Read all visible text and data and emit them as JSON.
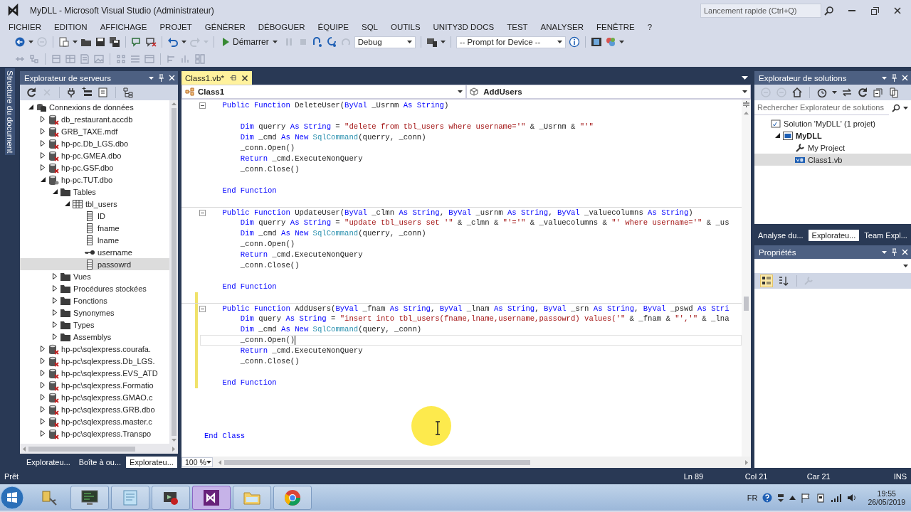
{
  "window": {
    "title": "MyDLL - Microsoft Visual Studio (Administrateur)",
    "quick_launch": {
      "placeholder": "Lancement rapide (Ctrl+Q)"
    }
  },
  "menu": [
    "FICHIER",
    "EDITION",
    "AFFICHAGE",
    "PROJET",
    "GÉNÉRER",
    "DÉBOGUER",
    "ÉQUIPE",
    "SQL",
    "OUTILS",
    "UNITY3D DOCS",
    "TEST",
    "ANALYSER",
    "FENÊTRE",
    "?"
  ],
  "toolbar": {
    "start": "Démarrer",
    "configuration": "Debug",
    "device": "-- Prompt for Device --"
  },
  "side_tab": "Structure du document",
  "server_explorer": {
    "title": "Explorateur de serveurs",
    "tree": [
      {
        "label": "Connexions de données",
        "kind": "connections",
        "expanded": true,
        "selected": false,
        "children": [
          {
            "label": "db_restaurant.accdb",
            "kind": "database",
            "connected": false,
            "expanded": false,
            "selected": false
          },
          {
            "label": "GRB_TAXE.mdf",
            "kind": "database",
            "connected": false,
            "expanded": false,
            "selected": false
          },
          {
            "label": "hp-pc.Db_LGS.dbo",
            "kind": "database",
            "connected": false,
            "expanded": false,
            "selected": false
          },
          {
            "label": "hp-pc.GMEA.dbo",
            "kind": "database",
            "connected": false,
            "expanded": false,
            "selected": false
          },
          {
            "label": "hp-pc.GSF.dbo",
            "kind": "database",
            "connected": false,
            "expanded": false,
            "selected": false
          },
          {
            "label": "hp-pc.TUT.dbo",
            "kind": "database",
            "connected": true,
            "expanded": true,
            "selected": false,
            "children": [
              {
                "label": "Tables",
                "kind": "folder",
                "expanded": true,
                "selected": false,
                "children": [
                  {
                    "label": "tbl_users",
                    "kind": "table",
                    "expanded": true,
                    "selected": false,
                    "children": [
                      {
                        "label": "ID",
                        "kind": "column",
                        "selected": false
                      },
                      {
                        "label": "fname",
                        "kind": "column",
                        "selected": false
                      },
                      {
                        "label": "lname",
                        "kind": "column",
                        "selected": false
                      },
                      {
                        "label": "username",
                        "kind": "key",
                        "selected": false
                      },
                      {
                        "label": "passowrd",
                        "kind": "column",
                        "selected": true
                      }
                    ]
                  }
                ]
              },
              {
                "label": "Vues",
                "kind": "folder",
                "expanded": false,
                "selected": false
              },
              {
                "label": "Procédures stockées",
                "kind": "folder",
                "expanded": false,
                "selected": false
              },
              {
                "label": "Fonctions",
                "kind": "folder",
                "expanded": false,
                "selected": false
              },
              {
                "label": "Synonymes",
                "kind": "folder",
                "expanded": false,
                "selected": false
              },
              {
                "label": "Types",
                "kind": "folder",
                "expanded": false,
                "selected": false
              },
              {
                "label": "Assemblys",
                "kind": "folder",
                "expanded": false,
                "selected": false
              }
            ]
          },
          {
            "label": "hp-pc\\sqlexpress.courafa.",
            "kind": "database",
            "connected": false,
            "expanded": false,
            "selected": false
          },
          {
            "label": "hp-pc\\sqlexpress.Db_LGS.",
            "kind": "database",
            "connected": false,
            "expanded": false,
            "selected": false
          },
          {
            "label": "hp-pc\\sqlexpress.EVS_ATD",
            "kind": "database",
            "connected": false,
            "expanded": false,
            "selected": false
          },
          {
            "label": "hp-pc\\sqlexpress.Formatio",
            "kind": "database",
            "connected": false,
            "expanded": false,
            "selected": false
          },
          {
            "label": "hp-pc\\sqlexpress.GMAO.c",
            "kind": "database",
            "connected": false,
            "expanded": false,
            "selected": false
          },
          {
            "label": "hp-pc\\sqlexpress.GRB.dbo",
            "kind": "database",
            "connected": false,
            "expanded": false,
            "selected": false
          },
          {
            "label": "hp-pc\\sqlexpress.master.c",
            "kind": "database",
            "connected": false,
            "expanded": false,
            "selected": false
          },
          {
            "label": "hp-pc\\sqlexpress.Transpo",
            "kind": "database",
            "connected": false,
            "expanded": false,
            "selected": false
          }
        ]
      }
    ],
    "tabs": [
      {
        "label": "Explorateu...",
        "selected": false
      },
      {
        "label": "Boîte à ou...",
        "selected": false
      },
      {
        "label": "Explorateu...",
        "selected": true
      }
    ]
  },
  "editor": {
    "tabs": [
      {
        "label": "Class1.vb*",
        "selected": true
      }
    ],
    "class_dropdown": "Class1",
    "member_dropdown": "AddUsers",
    "zoom": "100 %",
    "lines": [
      {
        "kind": "code",
        "collapsible": true,
        "segments": [
          {
            "kind": "keyword",
            "text": "    Public Function"
          },
          {
            "kind": "plain",
            "text": " DeleteUser("
          },
          {
            "kind": "keyword",
            "text": "ByVal"
          },
          {
            "kind": "plain",
            "text": " _Usrnm "
          },
          {
            "kind": "keyword",
            "text": "As String"
          },
          {
            "kind": "plain",
            "text": ")"
          }
        ]
      },
      {
        "kind": "blank"
      },
      {
        "kind": "code",
        "segments": [
          {
            "kind": "keyword",
            "text": "        Dim"
          },
          {
            "kind": "plain",
            "text": " querry "
          },
          {
            "kind": "keyword",
            "text": "As String"
          },
          {
            "kind": "plain",
            "text": " = "
          },
          {
            "kind": "string",
            "text": "\"delete from tbl_users where username='\""
          },
          {
            "kind": "plain",
            "text": " & _Usrnm & "
          },
          {
            "kind": "string",
            "text": "\"'\""
          }
        ]
      },
      {
        "kind": "code",
        "segments": [
          {
            "kind": "keyword",
            "text": "        Dim"
          },
          {
            "kind": "plain",
            "text": " _cmd "
          },
          {
            "kind": "keyword",
            "text": "As New"
          },
          {
            "kind": "type",
            "text": " SqlCommand"
          },
          {
            "kind": "plain",
            "text": "(querry, _conn)"
          }
        ]
      },
      {
        "kind": "code",
        "segments": [
          {
            "kind": "plain",
            "text": "        _conn.Open()"
          }
        ]
      },
      {
        "kind": "code",
        "segments": [
          {
            "kind": "keyword",
            "text": "        Return"
          },
          {
            "kind": "plain",
            "text": " _cmd.ExecuteNonQuery"
          }
        ]
      },
      {
        "kind": "code",
        "segments": [
          {
            "kind": "plain",
            "text": "        _conn.Close()"
          }
        ]
      },
      {
        "kind": "blank"
      },
      {
        "kind": "code",
        "segments": [
          {
            "kind": "keyword",
            "text": "    End Function"
          }
        ]
      },
      {
        "kind": "blank"
      },
      {
        "kind": "code",
        "collapsible": true,
        "segments": [
          {
            "kind": "keyword",
            "text": "    Public Function"
          },
          {
            "kind": "plain",
            "text": " UpdateUser("
          },
          {
            "kind": "keyword",
            "text": "ByVal"
          },
          {
            "kind": "plain",
            "text": " _clmn "
          },
          {
            "kind": "keyword",
            "text": "As String"
          },
          {
            "kind": "plain",
            "text": ", "
          },
          {
            "kind": "keyword",
            "text": "ByVal"
          },
          {
            "kind": "plain",
            "text": " _usrnm "
          },
          {
            "kind": "keyword",
            "text": "As String"
          },
          {
            "kind": "plain",
            "text": ", "
          },
          {
            "kind": "keyword",
            "text": "ByVal"
          },
          {
            "kind": "plain",
            "text": " _valuecolumns "
          },
          {
            "kind": "keyword",
            "text": "As String"
          },
          {
            "kind": "plain",
            "text": ")"
          }
        ]
      },
      {
        "kind": "code",
        "segments": [
          {
            "kind": "keyword",
            "text": "        Dim"
          },
          {
            "kind": "plain",
            "text": " querry "
          },
          {
            "kind": "keyword",
            "text": "As String"
          },
          {
            "kind": "plain",
            "text": " = "
          },
          {
            "kind": "string",
            "text": "\"update tbl_users set '\""
          },
          {
            "kind": "plain",
            "text": " & _clmn & "
          },
          {
            "kind": "string",
            "text": "\"'='\""
          },
          {
            "kind": "plain",
            "text": " & _valuecolumns & "
          },
          {
            "kind": "string",
            "text": "\"' where username='\""
          },
          {
            "kind": "plain",
            "text": " & _us"
          }
        ]
      },
      {
        "kind": "code",
        "segments": [
          {
            "kind": "keyword",
            "text": "        Dim"
          },
          {
            "kind": "plain",
            "text": " _cmd "
          },
          {
            "kind": "keyword",
            "text": "As New"
          },
          {
            "kind": "type",
            "text": " SqlCommand"
          },
          {
            "kind": "plain",
            "text": "(querry, _conn)"
          }
        ]
      },
      {
        "kind": "code",
        "segments": [
          {
            "kind": "plain",
            "text": "        _conn.Open()"
          }
        ]
      },
      {
        "kind": "code",
        "segments": [
          {
            "kind": "keyword",
            "text": "        Return"
          },
          {
            "kind": "plain",
            "text": " _cmd.ExecuteNonQuery"
          }
        ]
      },
      {
        "kind": "code",
        "segments": [
          {
            "kind": "plain",
            "text": "        _conn.Close()"
          }
        ]
      },
      {
        "kind": "blank"
      },
      {
        "kind": "code",
        "segments": [
          {
            "kind": "keyword",
            "text": "    End Function"
          }
        ]
      },
      {
        "kind": "blank",
        "changed": true
      },
      {
        "kind": "code",
        "collapsible": true,
        "changed": true,
        "segments": [
          {
            "kind": "keyword",
            "text": "    Public Function"
          },
          {
            "kind": "plain",
            "text": " AddUsers("
          },
          {
            "kind": "keyword",
            "text": "ByVal"
          },
          {
            "kind": "plain",
            "text": " _fnam "
          },
          {
            "kind": "keyword",
            "text": "As String"
          },
          {
            "kind": "plain",
            "text": ", "
          },
          {
            "kind": "keyword",
            "text": "ByVal"
          },
          {
            "kind": "plain",
            "text": " _lnam "
          },
          {
            "kind": "keyword",
            "text": "As String"
          },
          {
            "kind": "plain",
            "text": ", "
          },
          {
            "kind": "keyword",
            "text": "ByVal"
          },
          {
            "kind": "plain",
            "text": " _srn "
          },
          {
            "kind": "keyword",
            "text": "As String"
          },
          {
            "kind": "plain",
            "text": ", "
          },
          {
            "kind": "keyword",
            "text": "ByVal"
          },
          {
            "kind": "plain",
            "text": " _pswd "
          },
          {
            "kind": "keyword",
            "text": "As Stri"
          }
        ]
      },
      {
        "kind": "code",
        "changed": true,
        "segments": [
          {
            "kind": "keyword",
            "text": "        Dim"
          },
          {
            "kind": "plain",
            "text": " query "
          },
          {
            "kind": "keyword",
            "text": "As String"
          },
          {
            "kind": "plain",
            "text": " = "
          },
          {
            "kind": "string",
            "text": "\"insert into tbl_users(fname,lname,username,passowrd) values('\""
          },
          {
            "kind": "plain",
            "text": " & _fnam & "
          },
          {
            "kind": "string",
            "text": "\"','\""
          },
          {
            "kind": "plain",
            "text": " & _lna"
          }
        ]
      },
      {
        "kind": "code",
        "changed": true,
        "segments": [
          {
            "kind": "keyword",
            "text": "        Dim"
          },
          {
            "kind": "plain",
            "text": " _cmd "
          },
          {
            "kind": "keyword",
            "text": "As New"
          },
          {
            "kind": "type",
            "text": " SqlCommand"
          },
          {
            "kind": "plain",
            "text": "(query, _conn)"
          }
        ]
      },
      {
        "kind": "code",
        "changed": true,
        "current": true,
        "segments": [
          {
            "kind": "plain",
            "text": "        _conn.Open()"
          }
        ]
      },
      {
        "kind": "code",
        "changed": true,
        "segments": [
          {
            "kind": "keyword",
            "text": "        Return"
          },
          {
            "kind": "plain",
            "text": " _cmd.ExecuteNonQuery"
          }
        ]
      },
      {
        "kind": "code",
        "changed": true,
        "segments": [
          {
            "kind": "plain",
            "text": "        _conn.Close()"
          }
        ]
      },
      {
        "kind": "blank",
        "changed": true
      },
      {
        "kind": "code",
        "changed": true,
        "segments": [
          {
            "kind": "keyword",
            "text": "    End Function"
          }
        ]
      },
      {
        "kind": "blank"
      },
      {
        "kind": "blank"
      },
      {
        "kind": "blank"
      },
      {
        "kind": "blank"
      },
      {
        "kind": "code",
        "segments": [
          {
            "kind": "keyword",
            "text": "End Class"
          }
        ]
      }
    ]
  },
  "solution_explorer": {
    "title": "Explorateur de solutions",
    "search": {
      "placeholder": "Rechercher Explorateur de solutions"
    },
    "tree": [
      {
        "label": "Solution 'MyDLL' (1 projet)",
        "kind": "solution",
        "selected": false,
        "children": [
          {
            "label": "MyDLL",
            "kind": "project",
            "expanded": true,
            "selected": false,
            "children": [
              {
                "label": "My Project",
                "kind": "properties",
                "selected": false
              },
              {
                "label": "Class1.vb",
                "kind": "vb-file",
                "selected": true
              }
            ]
          }
        ]
      }
    ],
    "tabs": [
      {
        "label": "Analyse du...",
        "selected": false
      },
      {
        "label": "Explorateu...",
        "selected": true
      },
      {
        "label": "Team Expl...",
        "selected": false
      }
    ]
  },
  "properties": {
    "title": "Propriétés",
    "view_buttons": [
      {
        "kind": "categorized",
        "selected": true
      },
      {
        "kind": "alphabetical",
        "selected": false
      }
    ]
  },
  "status_bar": {
    "message": "Prêt",
    "line": "Ln 89",
    "column": "Col 21",
    "char": "Car 21",
    "mode": "INS"
  },
  "taskbar": {
    "apps": [
      {
        "kind": "server",
        "running": false,
        "selected": false
      },
      {
        "kind": "monitor",
        "running": true,
        "selected": false
      },
      {
        "kind": "notepad",
        "running": true,
        "selected": false
      },
      {
        "kind": "media",
        "running": true,
        "selected": false
      },
      {
        "kind": "ide",
        "running": true,
        "selected": true
      },
      {
        "kind": "folder",
        "running": true,
        "selected": false
      },
      {
        "kind": "browser",
        "running": true,
        "selected": false
      }
    ],
    "language": "FR",
    "time": "19:55",
    "date": "26/05/2019"
  }
}
